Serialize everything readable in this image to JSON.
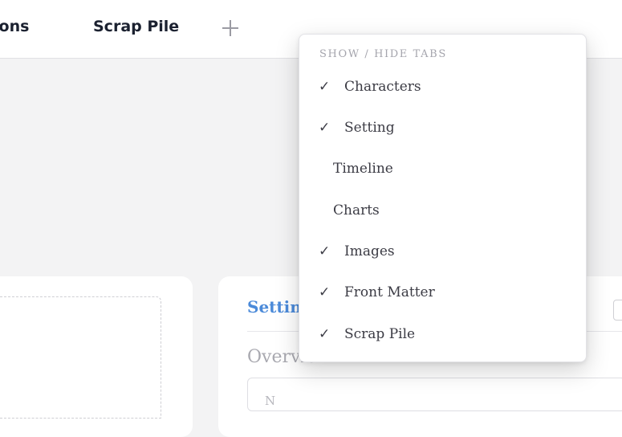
{
  "tabs": {
    "partial_tab_label": "ions",
    "scrap_pile_label": "Scrap Pile",
    "add_icon": "plus-icon"
  },
  "menu": {
    "heading": "SHOW / HIDE TABS",
    "check_glyph": "✓",
    "items": [
      {
        "label": "Characters",
        "checked": true
      },
      {
        "label": "Setting",
        "checked": true
      },
      {
        "label": "Timeline",
        "checked": false
      },
      {
        "label": "Charts",
        "checked": false
      },
      {
        "label": "Images",
        "checked": true
      },
      {
        "label": "Front Matter",
        "checked": true
      },
      {
        "label": "Scrap Pile",
        "checked": true
      }
    ]
  },
  "background_card": {
    "title_partial": "Settin",
    "subtitle_partial": "Overview",
    "field_placeholder_partial": "N"
  },
  "colors": {
    "accent": "#4b8ad9",
    "tab_text": "#1b2130",
    "page_bg": "#f3f3f4"
  }
}
